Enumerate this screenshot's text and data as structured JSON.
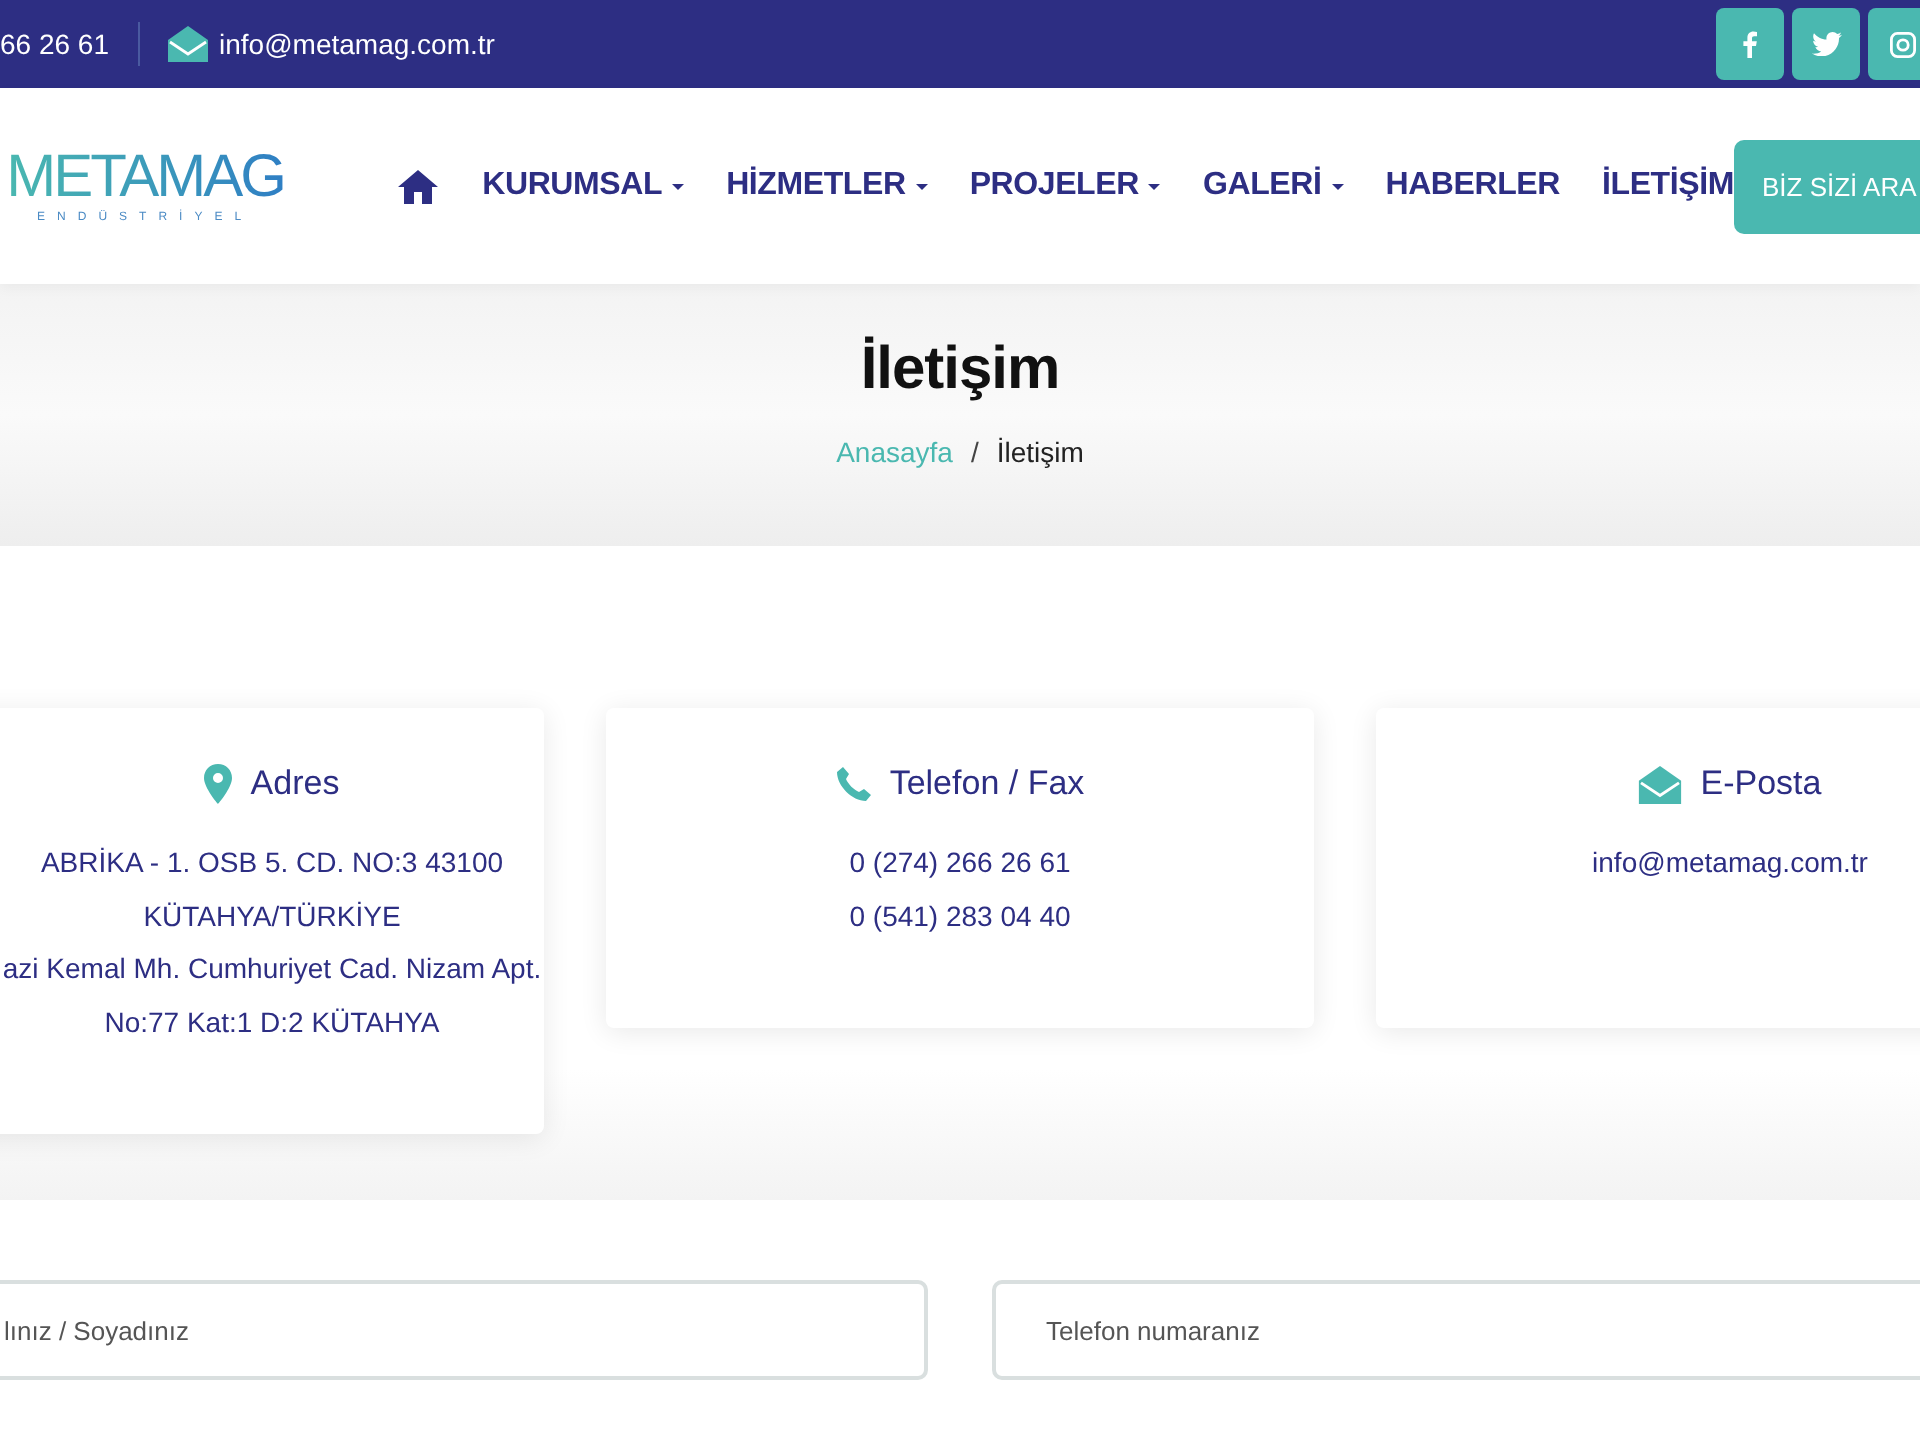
{
  "top_bar": {
    "phone": "66 26 61",
    "email": "info@metamag.com.tr"
  },
  "nav": {
    "logo": {
      "name": "METAMAG",
      "tagline": "ENDÜSTRİYEL"
    },
    "items": [
      {
        "label": "KURUMSAL",
        "dropdown": true
      },
      {
        "label": "HİZMETLER",
        "dropdown": true
      },
      {
        "label": "PROJELER",
        "dropdown": true
      },
      {
        "label": "GALERİ",
        "dropdown": true
      },
      {
        "label": "HABERLER",
        "dropdown": false
      },
      {
        "label": "İLETİŞİM",
        "dropdown": false
      }
    ],
    "cta": "BİZ SİZİ ARA"
  },
  "page_header": {
    "title": "İletişim",
    "separator": "/",
    "breadcrumb": [
      {
        "label": "Anasayfa",
        "link": true
      },
      {
        "label": "İletişim",
        "link": false
      }
    ]
  },
  "contact_cards": [
    {
      "kind": "address",
      "title": "Adres",
      "lines": [
        "ABRİKA - 1. OSB 5. CD. NO:3 43100",
        "KÜTAHYA/TÜRKİYE",
        "azi Kemal Mh. Cumhuriyet Cad. Nizam Apt.",
        "No:77 Kat:1 D:2 KÜTAHYA"
      ]
    },
    {
      "kind": "phone",
      "title": "Telefon / Fax",
      "lines": [
        "0 (274) 266 26 61",
        "0 (541) 283 04 40"
      ]
    },
    {
      "kind": "email",
      "title": "E-Posta",
      "lines": [
        "info@metamag.com.tr"
      ]
    }
  ],
  "form": {
    "fields": [
      {
        "placeholder": "lınız / Soyadınız"
      },
      {
        "placeholder": "Telefon numaranız"
      }
    ]
  }
}
